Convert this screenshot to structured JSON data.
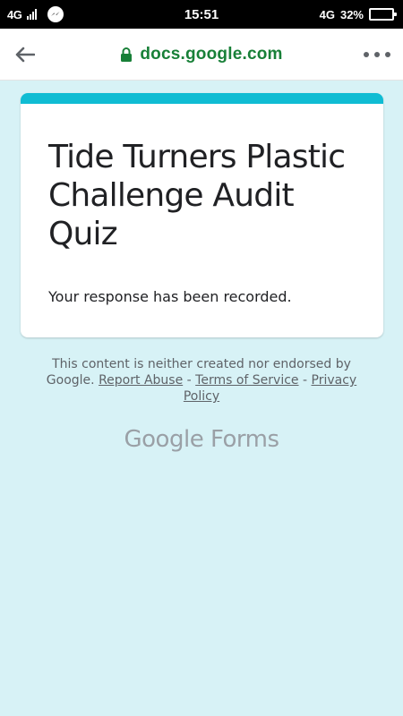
{
  "status_bar": {
    "network_left": "4G",
    "time": "15:51",
    "network_right": "4G",
    "battery_percent": "32%",
    "battery_level": 0.32
  },
  "browser": {
    "url": "docs.google.com",
    "icons": {
      "back": "back-arrow-icon",
      "lock": "lock-icon",
      "menu": "more-dots-icon"
    }
  },
  "form": {
    "title": "Tide Turners Plastic Challenge Audit Quiz",
    "confirmation": "Your response has been recorded.",
    "accent_color": "#0fbcd3"
  },
  "footer": {
    "disclaimer": "This content is neither created nor endorsed by Google.",
    "report_abuse": "Report Abuse",
    "separator": "-",
    "terms": "Terms of Service",
    "privacy": "Privacy Policy"
  },
  "logo": {
    "google": "Google",
    "forms": "Forms"
  },
  "colors": {
    "page_background": "#d7f2f6",
    "url_green": "#188038"
  }
}
